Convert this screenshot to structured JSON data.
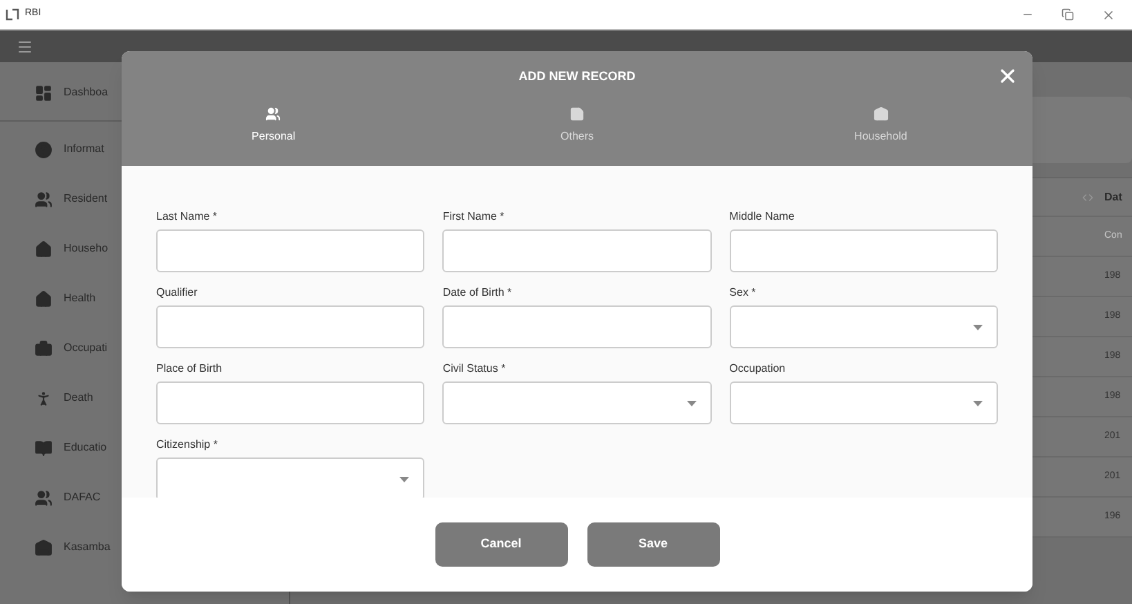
{
  "window": {
    "title": "RBI"
  },
  "sidebar": {
    "items": [
      {
        "label": "Dashboa"
      },
      {
        "label": "Informat"
      },
      {
        "label": "Resident"
      },
      {
        "label": "Househo"
      },
      {
        "label": "Health"
      },
      {
        "label": "Occupati"
      },
      {
        "label": "Death"
      },
      {
        "label": "Educatio"
      },
      {
        "label": "DAFAC"
      },
      {
        "label": "Kasamba"
      }
    ]
  },
  "table": {
    "columns": [
      "Dat"
    ],
    "rows": [
      "Con",
      "198",
      "198",
      "198",
      "198",
      "201",
      "201",
      "196"
    ]
  },
  "modal": {
    "title": "ADD NEW RECORD",
    "tabs": [
      {
        "label": "Personal",
        "selected": true
      },
      {
        "label": "Others",
        "selected": false
      },
      {
        "label": "Household",
        "selected": false
      }
    ],
    "fields": [
      {
        "label": "Last Name *",
        "kind": "text"
      },
      {
        "label": "First Name *",
        "kind": "text"
      },
      {
        "label": "Middle Name",
        "kind": "text"
      },
      {
        "label": "Qualifier",
        "kind": "text"
      },
      {
        "label": "Date of Birth *",
        "kind": "text"
      },
      {
        "label": "Sex *",
        "kind": "select"
      },
      {
        "label": "Place of Birth",
        "kind": "text"
      },
      {
        "label": "Civil Status *",
        "kind": "select"
      },
      {
        "label": "Occupation",
        "kind": "select"
      },
      {
        "label": "Citizenship *",
        "kind": "select"
      }
    ],
    "buttons": [
      "Cancel",
      "Save"
    ]
  }
}
